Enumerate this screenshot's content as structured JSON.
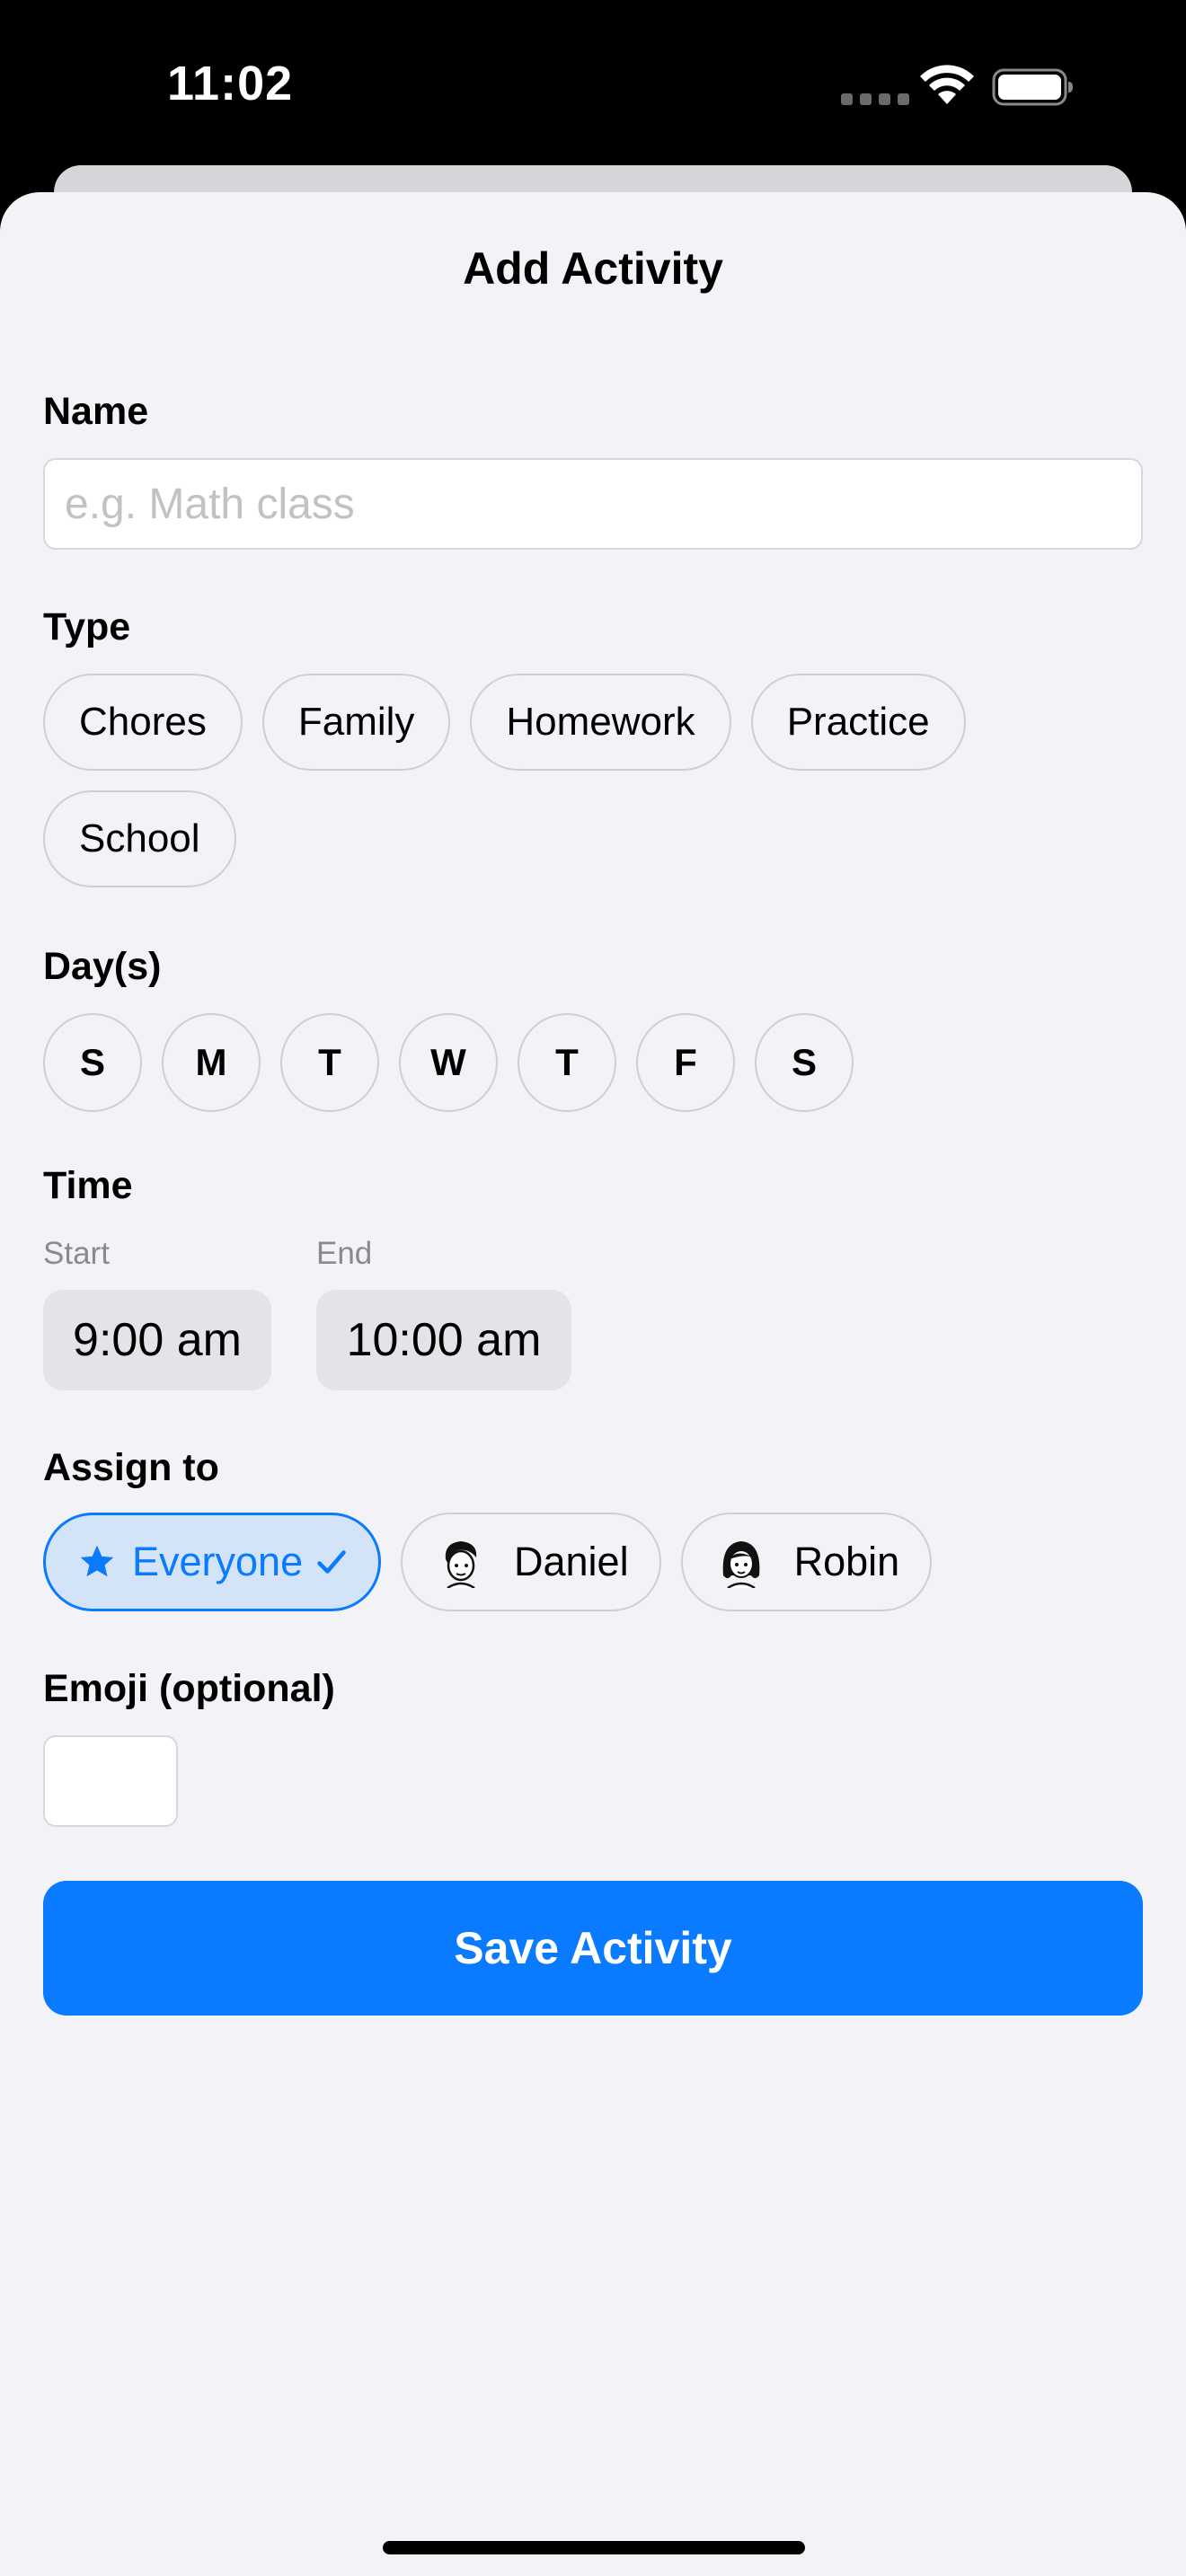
{
  "status_bar": {
    "time": "11:02"
  },
  "sheet": {
    "title": "Add Activity",
    "name": {
      "label": "Name",
      "placeholder": "e.g. Math class",
      "value": ""
    },
    "type": {
      "label": "Type",
      "options": [
        "Chores",
        "Family",
        "Homework",
        "Practice",
        "School"
      ]
    },
    "days": {
      "label": "Day(s)",
      "options": [
        "S",
        "M",
        "T",
        "W",
        "T",
        "F",
        "S"
      ]
    },
    "time": {
      "label": "Time",
      "start": {
        "label": "Start",
        "value": "9:00 am"
      },
      "end": {
        "label": "End",
        "value": "10:00 am"
      }
    },
    "assign": {
      "label": "Assign to",
      "options": [
        {
          "name": "Everyone",
          "selected": true,
          "icon": "star-icon"
        },
        {
          "name": "Daniel",
          "selected": false,
          "icon": "avatar-daniel"
        },
        {
          "name": "Robin",
          "selected": false,
          "icon": "avatar-robin"
        }
      ]
    },
    "emoji": {
      "label": "Emoji (optional)",
      "value": ""
    },
    "save_label": "Save Activity"
  },
  "colors": {
    "accent": "#0a7aff",
    "selected_bg": "#d4e4f8",
    "sheet_bg": "#f2f2f7"
  }
}
